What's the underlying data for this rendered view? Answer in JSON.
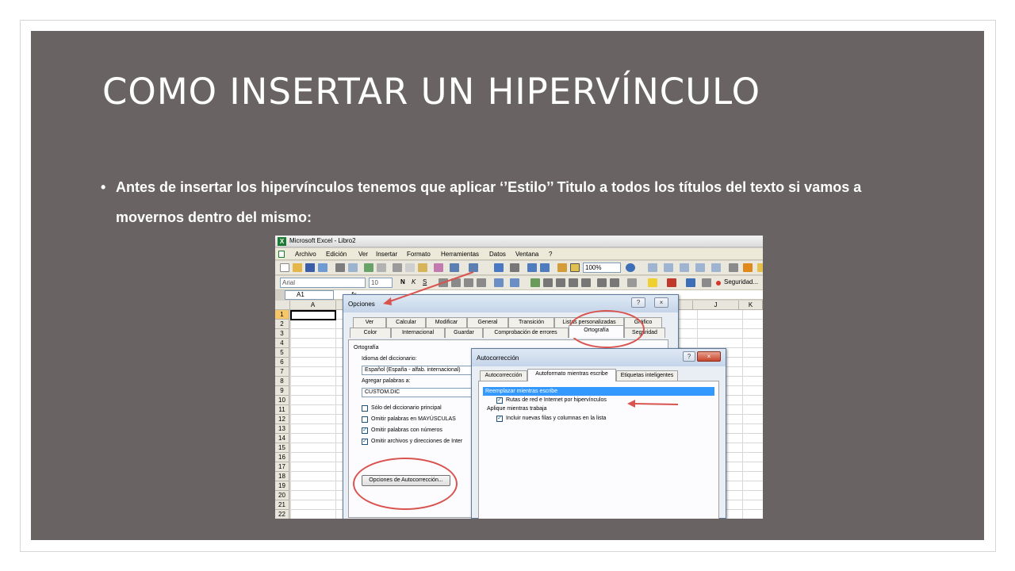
{
  "slide": {
    "title": "COMO INSERTAR UN HIPERVÍNCULO",
    "bullet_mark": "•",
    "bullet_text": "Antes de insertar los hipervínculos tenemos que aplicar ‘’Estilo’’ Titulo a todos los títulos del texto si vamos a movernos dentro del mismo:"
  },
  "excel": {
    "window_title": "Microsoft Excel - Libro2",
    "app_icon": "X",
    "menu": [
      "Archivo",
      "Edición",
      "Ver",
      "Insertar",
      "Formato",
      "Herramientas",
      "Datos",
      "Ventana",
      "?"
    ],
    "zoom": "100%",
    "font_name": "Arial",
    "font_size": "10",
    "bold": "N",
    "italic": "K",
    "underline": "S",
    "security_label": "Seguridad...",
    "name_box": "A1",
    "fx": "fx",
    "columns": [
      "A",
      "J",
      "K"
    ],
    "rows": [
      "1",
      "2",
      "3",
      "4",
      "5",
      "6",
      "7",
      "8",
      "9",
      "10",
      "11",
      "12",
      "13",
      "14",
      "15",
      "16",
      "17",
      "18",
      "19",
      "20",
      "21",
      "22"
    ]
  },
  "options_dialog": {
    "title": "Opciones",
    "help_glyph": "?",
    "close_glyph": "×",
    "tabs_row1": [
      "Ver",
      "Calcular",
      "Modificar",
      "General",
      "Transición",
      "Listas personalizadas",
      "Gráfico"
    ],
    "tabs_row2": [
      "Color",
      "Internacional",
      "Guardar",
      "Comprobación de errores",
      "Ortografía",
      "Seguridad"
    ],
    "section": "Ortografía",
    "dict_label": "Idioma del diccionario:",
    "dict_value": "Español (España - alfab. internacional)",
    "add_words_label": "Agregar palabras a:",
    "add_words_value": "CUSTOM.DIC",
    "checks": [
      {
        "label": "Sólo del diccionario principal",
        "checked": false
      },
      {
        "label": "Omitir palabras en MAYÚSCULAS",
        "checked": false
      },
      {
        "label": "Omitir palabras con números",
        "checked": true
      },
      {
        "label": "Omitir archivos y direcciones de Inter",
        "checked": true
      }
    ],
    "autocorrect_button": "Opciones de Autocorrección..."
  },
  "autocorrect_dialog": {
    "title": "Autocorrección",
    "help_glyph": "?",
    "close_glyph": "×",
    "tabs": [
      "Autocorrección",
      "Autoformato mientras escribe",
      "Etiquetas inteligentes"
    ],
    "replace_header": "Reemplazar mientras escribe",
    "paths_option": "Rutas de red e Internet por hipervínculos",
    "apply_header": "Aplique mientras trabaja",
    "list_option": "Incluir nuevas filas y columnas en la lista",
    "check_glyph": "✓"
  },
  "colors": {
    "slide_bg": "#696463",
    "annotation": "#d9534f",
    "selection": "#3399ff"
  }
}
